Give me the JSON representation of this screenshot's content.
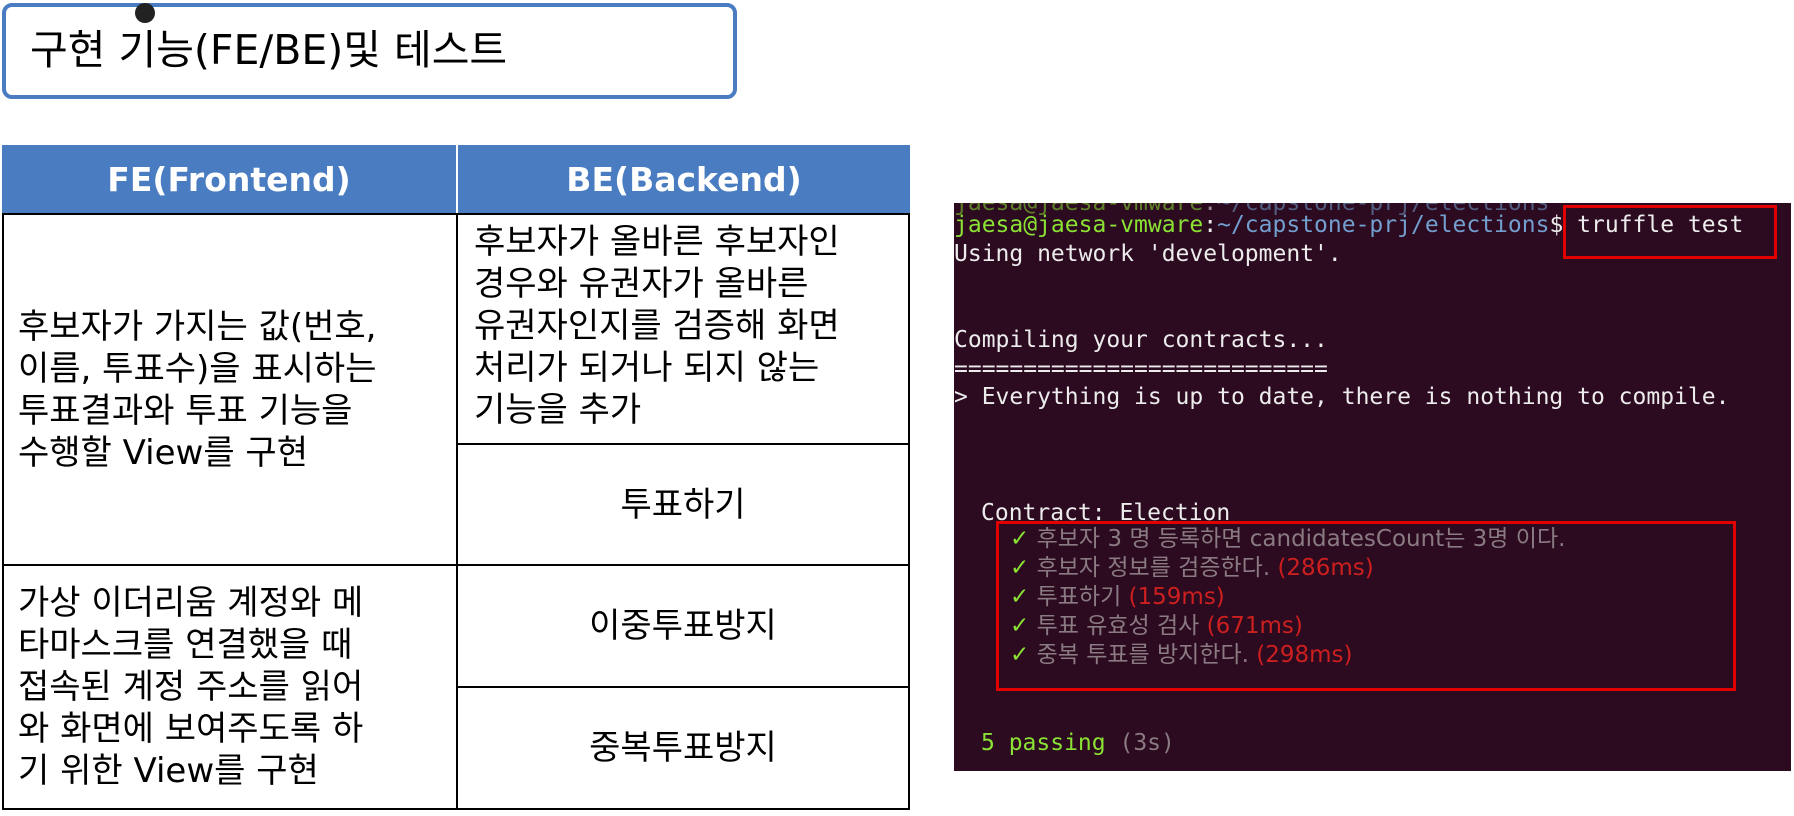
{
  "title": "구현 기능(FE/BE)및 테스트",
  "table": {
    "headers": {
      "fe": "FE(Frontend)",
      "be": "BE(Backend)"
    },
    "fe_rows": [
      "후보자가 가지는 값(번호,\n이름, 투표수)을 표시하는\n투표결과와 투표 기능을\n수행할 View를 구현",
      "가상 이더리움 계정와 메\n타마스크를 연결했을 때\n접속된 계정 주소를 읽어\n와 화면에 보여주도록 하\n기 위한 View를 구현"
    ],
    "be_rows": [
      "후보자가 올바른 후보자인\n경우와 유권자가 올바른\n유권자인지를 검증해 화면\n처리가 되거나 되지 않는\n기능을 추가",
      "투표하기",
      "이중투표방지",
      "중복투표방지"
    ]
  },
  "terminal": {
    "prompt_user": "jaesa@jaesa-vmware",
    "prompt_path": "~/capstone-prj/elections",
    "command": "truffle test",
    "network_line": "Using network 'development'.",
    "compiling_line": "Compiling your contracts...",
    "separator": "===========================",
    "up_to_date_line": "> Everything is up to date, there is nothing to compile.",
    "contract_line": "Contract: Election",
    "tests": [
      {
        "name": "후보자 3 명 등록하면 candidatesCount는 3명 이다.",
        "time": ""
      },
      {
        "name": "후보자 정보를 검증한다.",
        "time": "(286ms)"
      },
      {
        "name": "투표하기",
        "time": "(159ms)"
      },
      {
        "name": "투표 유효성 검사",
        "time": "(671ms)"
      },
      {
        "name": "중복 투표를 방지한다.",
        "time": "(298ms)"
      }
    ],
    "check_mark": "✓",
    "passing": "5 passing",
    "passing_time": "(3s)"
  },
  "colors": {
    "header_blue": "#4a7cc2",
    "terminal_bg": "#2c0a1f",
    "highlight_red": "#e00000",
    "pass_green": "#8ae234"
  }
}
